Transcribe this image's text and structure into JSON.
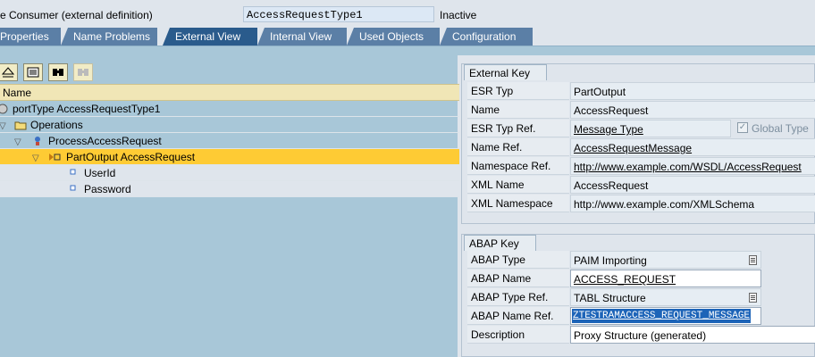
{
  "header": {
    "label": "e Consumer (external definition)",
    "name_value": "AccessRequestType1",
    "status": "Inactive"
  },
  "tabs": [
    {
      "label": "Properties"
    },
    {
      "label": "Name Problems"
    },
    {
      "label": "External View"
    },
    {
      "label": "Internal View"
    },
    {
      "label": "Used Objects"
    },
    {
      "label": "Configuration"
    }
  ],
  "active_tab": "External View",
  "toolbar": {
    "buttons": [
      "collapse-all-icon",
      "details-icon",
      "find-icon",
      "find-next-icon"
    ]
  },
  "tree": {
    "column_header": "Name",
    "rows": [
      {
        "text": "portType AccessRequestType1",
        "icon": "porttype-icon"
      },
      {
        "text": "Operations",
        "icon": "folder-icon"
      },
      {
        "text": "ProcessAccessRequest",
        "icon": "operation-icon"
      },
      {
        "text": "PartOutput AccessRequest",
        "icon": "part-icon",
        "selected": true
      },
      {
        "text": "UserId",
        "icon": "element-icon"
      },
      {
        "text": "Password",
        "icon": "element-icon"
      }
    ]
  },
  "external_key": {
    "title": "External Key",
    "fields": [
      {
        "label": "ESR Typ",
        "value": "PartOutput"
      },
      {
        "label": "Name",
        "value": "AccessRequest"
      },
      {
        "label": "ESR Typ Ref.",
        "value": "Message Type",
        "checkbox_label": "Global Type",
        "checkbox_checked": true
      },
      {
        "label": "Name Ref.",
        "value": "AccessRequestMessage"
      },
      {
        "label": "Namespace Ref.",
        "value": "http://www.example.com/WSDL/AccessRequest"
      },
      {
        "label": "XML Name",
        "value": "AccessRequest"
      },
      {
        "label": "XML Namespace",
        "value": "http://www.example.com/XMLSchema"
      }
    ]
  },
  "abap_key": {
    "title": "ABAP Key",
    "fields": [
      {
        "label": "ABAP Type",
        "value": "PAIM Importing"
      },
      {
        "label": "ABAP Name",
        "value": "ACCESS_REQUEST"
      },
      {
        "label": "ABAP Type Ref.",
        "value": "TABL Structure"
      },
      {
        "label": "ABAP Name Ref.",
        "value": "ZTESTRAMACCESS_REQUEST_MESSAGE"
      },
      {
        "label": "Description",
        "value": "Proxy Structure (generated)"
      }
    ]
  },
  "colors": {
    "tab": "#5b7fa6",
    "tab_active": "#2a5b8c",
    "tree_bg": "#a8c7d8",
    "selection": "#fecb34",
    "field_selected": "#1d64b8"
  }
}
